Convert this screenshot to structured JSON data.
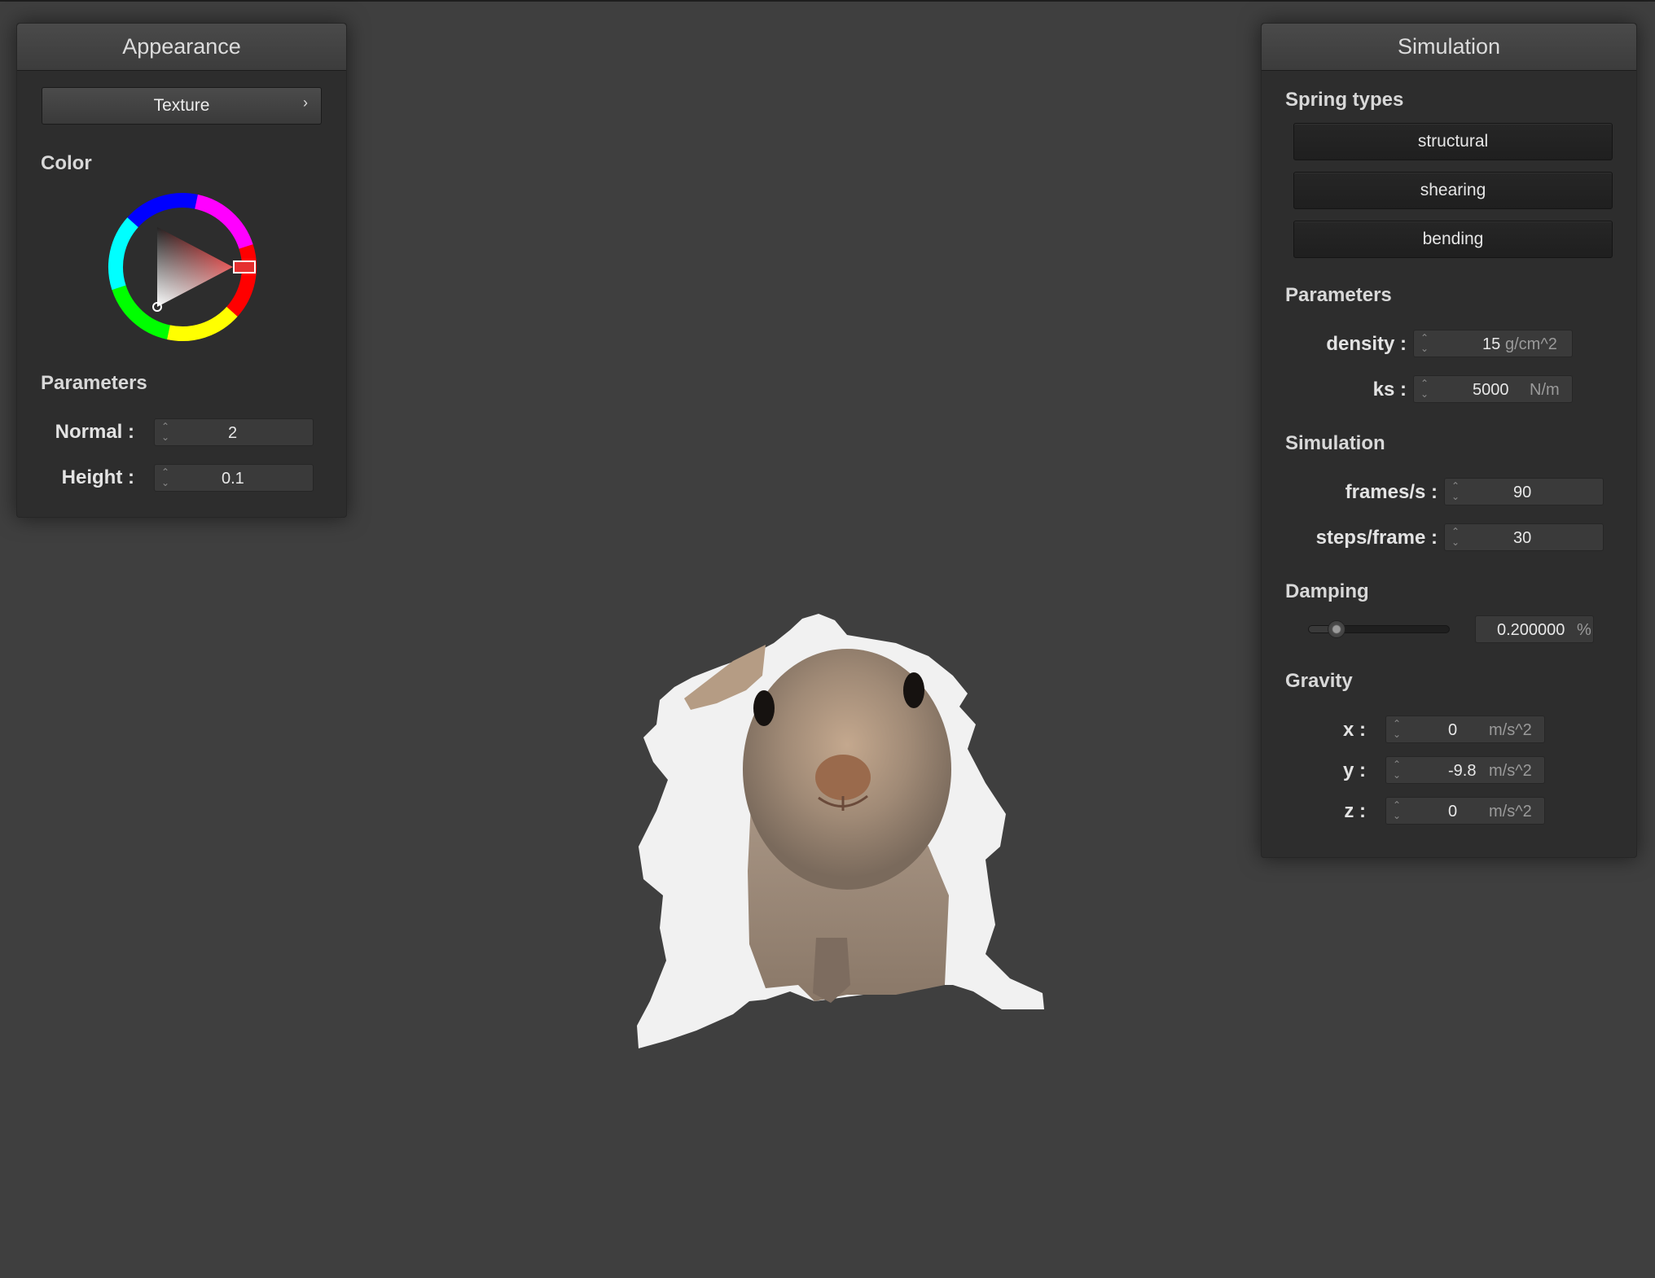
{
  "appearance": {
    "title": "Appearance",
    "texture_button": "Texture",
    "color_label": "Color",
    "parameters_label": "Parameters",
    "normal_label": "Normal :",
    "normal_value": "2",
    "height_label": "Height :",
    "height_value": "0.1",
    "selected_color": "#e53030"
  },
  "simulation": {
    "title": "Simulation",
    "spring_types_label": "Spring types",
    "spring_types": [
      "structural",
      "shearing",
      "bending"
    ],
    "parameters_label": "Parameters",
    "density_label": "density :",
    "density_value": "15",
    "density_unit": "g/cm^2",
    "ks_label": "ks :",
    "ks_value": "5000",
    "ks_unit": "N/m",
    "simulation_label": "Simulation",
    "fps_label": "frames/s :",
    "fps_value": "90",
    "steps_label": "steps/frame :",
    "steps_value": "30",
    "damping_label": "Damping",
    "damping_value": "0.200000",
    "damping_unit": "%",
    "damping_slider_fraction": 0.2,
    "gravity_label": "Gravity",
    "gx_label": "x :",
    "gx_value": "0",
    "gy_label": "y :",
    "gy_value": "-9.8",
    "gz_label": "z :",
    "gz_value": "0",
    "gravity_unit": "m/s^2"
  },
  "icons": {
    "spinner": "up-down-arrows-icon",
    "chevron": "chevron-right-icon"
  }
}
